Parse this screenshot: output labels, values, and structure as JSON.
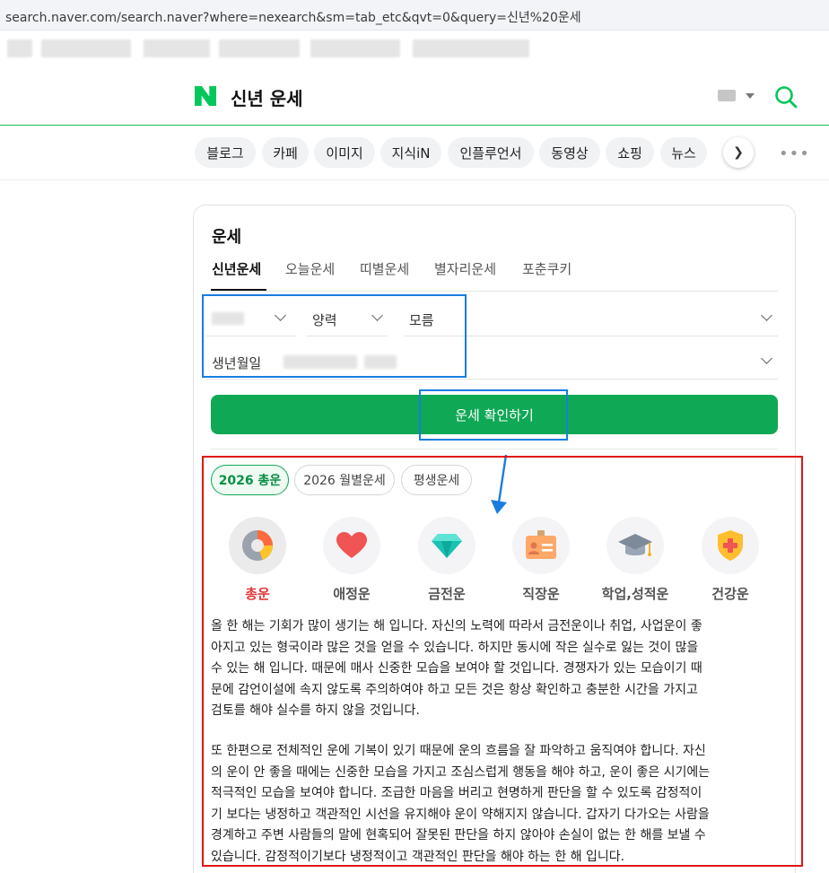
{
  "browser": {
    "url": "search.naver.com/search.naver?where=nexearch&sm=tab_etc&qvt=0&query=신년%20운세"
  },
  "header": {
    "logo_icon": "naver-n-logo-icon",
    "title": "신년 운세",
    "keyboard_icon": "keyboard-icon",
    "search_icon": "search-icon",
    "brand_color": "#03c75a"
  },
  "search_tabs": {
    "items": [
      "블로그",
      "카페",
      "이미지",
      "지식iN",
      "인플루언서",
      "동영상",
      "쇼핑",
      "뉴스"
    ],
    "next_icon": "chevron-right-icon",
    "more_icon": "more-dots-icon"
  },
  "fortune": {
    "title": "운세",
    "tabs": [
      "신년운세",
      "오늘운세",
      "띠별운세",
      "별자리운세",
      "포춘쿠키"
    ],
    "active_tab": "신년운세",
    "calendar_select": "양력",
    "birth_time_select": "모름",
    "birth_date_label": "생년월일",
    "confirm_label": "운세 확인하기",
    "period_tabs": [
      "2026 총운",
      "2026 월별운세",
      "평생운세"
    ],
    "categories": [
      {
        "label": "총운",
        "icon": "donut-chart-icon",
        "active": true
      },
      {
        "label": "애정운",
        "icon": "heart-icon",
        "active": false
      },
      {
        "label": "금전운",
        "icon": "diamond-icon",
        "active": false
      },
      {
        "label": "직장운",
        "icon": "id-badge-icon",
        "active": false
      },
      {
        "label": "학업,성적운",
        "icon": "graduation-cap-icon",
        "active": false
      },
      {
        "label": "건강운",
        "icon": "health-shield-icon",
        "active": false
      }
    ],
    "paragraph1": [
      "올 한 해는 기회가 많이 생기는 해 입니다. 자신의 노력에 따라서 금전운이나 취업, 사업운이 좋",
      "아지고 있는 형국이라 많은 것을 얻을 수 있습니다. 하지만 동시에 작은 실수로 잃는 것이 많을",
      "수 있는 해 입니다. 때문에 매사 신중한 모습을 보여야 할 것입니다. 경쟁자가 있는 모습이기 때",
      "문에 감언이설에 속지 않도록 주의하여야 하고 모든 것은 항상 확인하고 충분한 시간을 가지고",
      "검토를 해야 실수를 하지 않을 것입니다."
    ],
    "paragraph2": [
      "또 한편으로 전체적인 운에 기복이 있기 때문에 운의 흐름을 잘 파악하고 움직여야 합니다. 자신",
      "의 운이 안 좋을 때에는 신중한 모습을 가지고 조심스럽게 행동을 해야 하고, 운이 좋은 시기에는",
      "적극적인 모습을 보여야 합니다. 조급한 마음을 버리고 현명하게 판단을 할 수 있도록 감정적이",
      "기 보다는 냉정하고 객관적인 시선을 유지해야 운이 약해지지 않습니다. 갑자기 다가오는 사람을",
      "경계하고 주변 사람들의 말에 현혹되어 잘못된 판단을 하지 않아야 손실이 없는 한 해를 보낼 수",
      "있습니다. 감정적이기보다 냉정적이고 객관적인 판단을 해야 하는 한 해 입니다."
    ]
  },
  "annotation_colors": {
    "blue": "#1a7ce0",
    "red": "#e01515"
  }
}
